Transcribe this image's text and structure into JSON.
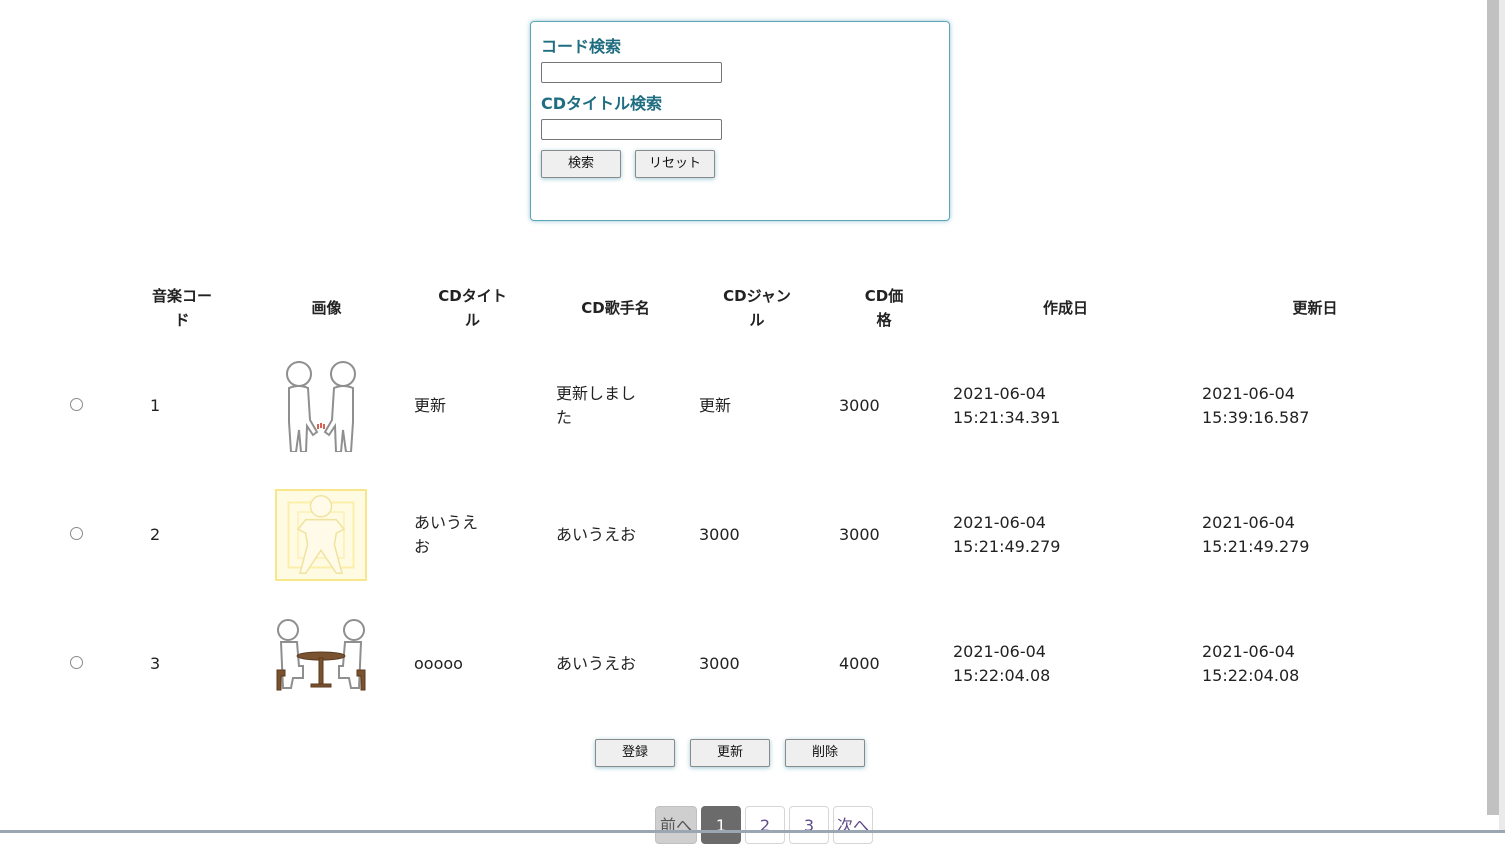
{
  "search": {
    "code_label": "コード検索",
    "code_value": "",
    "title_label": "CDタイトル検索",
    "title_value": "",
    "search_button": "検索",
    "reset_button": "リセット"
  },
  "table": {
    "headers": {
      "code": "音楽コード",
      "image": "画像",
      "title": "CDタイトル",
      "artist": "CD歌手名",
      "genre": "CDジャンル",
      "price": "CD価格",
      "created": "作成日",
      "updated": "更新日"
    },
    "rows": [
      {
        "code": "1",
        "image": "two-figures-holding-hands",
        "title": "更新",
        "artist": "更新しました",
        "genre": "更新",
        "price": "3000",
        "created": "2021-06-04 15:21:34.391",
        "updated": "2021-06-04 15:39:16.587"
      },
      {
        "code": "2",
        "image": "glowing-figure",
        "title": "あいうえお",
        "artist": "あいうえお",
        "genre": "3000",
        "price": "3000",
        "created": "2021-06-04 15:21:49.279",
        "updated": "2021-06-04 15:21:49.279"
      },
      {
        "code": "3",
        "image": "two-figures-at-table",
        "title": "ooooo",
        "artist": "あいうえお",
        "genre": "3000",
        "price": "4000",
        "created": "2021-06-04 15:22:04.08",
        "updated": "2021-06-04 15:22:04.08"
      }
    ]
  },
  "actions": {
    "register": "登録",
    "update": "更新",
    "delete": "削除"
  },
  "pagination": {
    "prev": "前へ",
    "pages": [
      "1",
      "2",
      "3"
    ],
    "current": "1",
    "next": "次へ"
  }
}
